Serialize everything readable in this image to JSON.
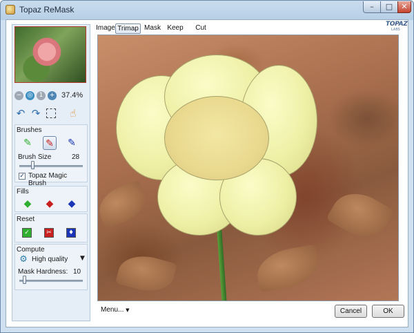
{
  "window": {
    "title": "Topaz ReMask",
    "controls": {
      "minimize": "–",
      "maximize": "□",
      "close": "✕"
    }
  },
  "tabs": [
    {
      "label": "Image",
      "active": false
    },
    {
      "label": "Trimap",
      "active": true
    },
    {
      "label": "Mask",
      "active": false
    },
    {
      "label": "Keep",
      "active": false
    },
    {
      "label": "Cut",
      "active": false
    }
  ],
  "logo": {
    "text": "TOPAZ",
    "sub": "LABS"
  },
  "left_panel": {
    "zoom_percent": "37.4%",
    "zoom_icons": [
      "zoom-out-icon",
      "zoom-fit-icon",
      "zoom-actual-icon",
      "zoom-in-icon"
    ],
    "tools": [
      "undo-icon",
      "redo-icon",
      "selection-icon",
      "hand-icon"
    ],
    "brushes": {
      "title": "Brushes",
      "brush_size_label": "Brush Size",
      "brush_size_value": "28",
      "magic_brush_label": "Topaz Magic Brush",
      "magic_brush_checked": true,
      "magic_brush_mark": "✓"
    },
    "fills": {
      "title": "Fills"
    },
    "reset": {
      "title": "Reset"
    },
    "compute": {
      "title": "Compute",
      "quality_value": "High quality",
      "mask_hardness_label": "Mask Hardness:",
      "mask_hardness_value": "10"
    }
  },
  "bottom": {
    "menu_label": "Menu...",
    "cancel_label": "Cancel",
    "ok_label": "OK"
  },
  "colors": {
    "keep_green": "#2fae2f",
    "cut_red": "#c82020",
    "compute_blue": "#1a35b8",
    "selected_border": "#6d86a6"
  }
}
